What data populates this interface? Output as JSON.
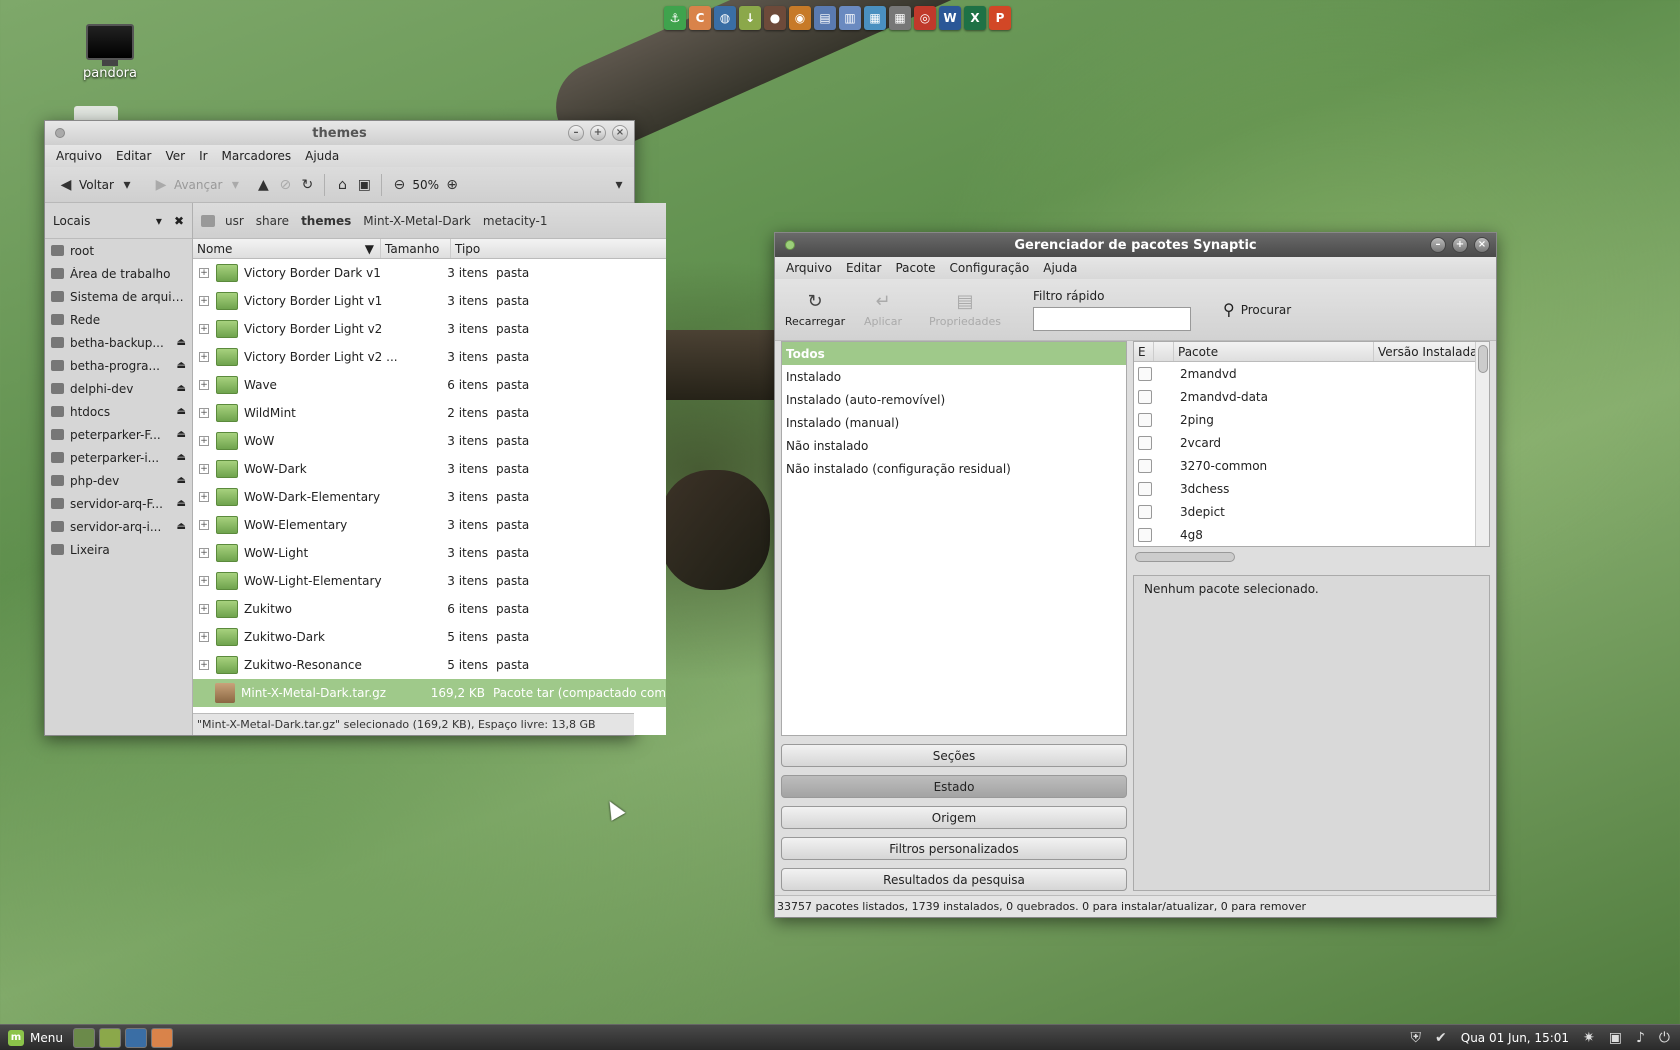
{
  "desktop": {
    "icons": [
      {
        "label": "pandora"
      }
    ]
  },
  "launcher": {
    "icons": [
      {
        "name": "anchor-icon",
        "color": "#3fa34d",
        "glyph": "⚓"
      },
      {
        "name": "c-app-icon",
        "color": "#d9834a",
        "glyph": "C"
      },
      {
        "name": "globe-icon",
        "color": "#3a6ea5",
        "glyph": "◍"
      },
      {
        "name": "install-icon",
        "color": "#8ba84a",
        "glyph": "↓"
      },
      {
        "name": "record-icon",
        "color": "#6d4a3a",
        "glyph": "●"
      },
      {
        "name": "eye-icon",
        "color": "#c77a28",
        "glyph": "◉"
      },
      {
        "name": "document-icon",
        "color": "#5a7ab0",
        "glyph": "▤"
      },
      {
        "name": "chart-icon",
        "color": "#6a8ac0",
        "glyph": "▥"
      },
      {
        "name": "monitor-icon",
        "color": "#4a90c0",
        "glyph": "▦"
      },
      {
        "name": "calc-icon",
        "color": "#777777",
        "glyph": "▦"
      },
      {
        "name": "lifebuoy-icon",
        "color": "#c0392b",
        "glyph": "◎"
      },
      {
        "name": "word-icon",
        "color": "#2b5797",
        "glyph": "W"
      },
      {
        "name": "excel-icon",
        "color": "#1e7145",
        "glyph": "X"
      },
      {
        "name": "powerpoint-icon",
        "color": "#d24726",
        "glyph": "P"
      }
    ]
  },
  "themes_window": {
    "title": "themes",
    "menu": [
      "Arquivo",
      "Editar",
      "Ver",
      "Ir",
      "Marcadores",
      "Ajuda"
    ],
    "toolbar": {
      "back": "Voltar",
      "forward": "Avançar",
      "zoom": "50%"
    },
    "sidebar": {
      "title": "Locais",
      "items": [
        {
          "label": "root",
          "eject": false
        },
        {
          "label": "Área de trabalho",
          "eject": false
        },
        {
          "label": "Sistema de arquivos",
          "eject": false
        },
        {
          "label": "Rede",
          "eject": false
        },
        {
          "label": "betha-backup...",
          "eject": true
        },
        {
          "label": "betha-progra...",
          "eject": true
        },
        {
          "label": "delphi-dev",
          "eject": true
        },
        {
          "label": "htdocs",
          "eject": true
        },
        {
          "label": "peterparker-F...",
          "eject": true
        },
        {
          "label": "peterparker-i...",
          "eject": true
        },
        {
          "label": "php-dev",
          "eject": true
        },
        {
          "label": "servidor-arq-F...",
          "eject": true
        },
        {
          "label": "servidor-arq-i...",
          "eject": true
        },
        {
          "label": "Lixeira",
          "eject": false
        }
      ]
    },
    "path": [
      "usr",
      "share",
      "themes",
      "Mint-X-Metal-Dark",
      "metacity-1"
    ],
    "columns": {
      "name": "Nome",
      "size": "Tamanho",
      "type": "Tipo"
    },
    "files": [
      {
        "name": "Victory Border Dark v1",
        "size": "3 itens",
        "type": "pasta"
      },
      {
        "name": "Victory Border Light v1",
        "size": "3 itens",
        "type": "pasta"
      },
      {
        "name": "Victory Border Light v2",
        "size": "3 itens",
        "type": "pasta"
      },
      {
        "name": "Victory Border Light v2 ...",
        "size": "3 itens",
        "type": "pasta"
      },
      {
        "name": "Wave",
        "size": "6 itens",
        "type": "pasta"
      },
      {
        "name": "WildMint",
        "size": "2 itens",
        "type": "pasta"
      },
      {
        "name": "WoW",
        "size": "3 itens",
        "type": "pasta"
      },
      {
        "name": "WoW-Dark",
        "size": "3 itens",
        "type": "pasta"
      },
      {
        "name": "WoW-Dark-Elementary",
        "size": "3 itens",
        "type": "pasta"
      },
      {
        "name": "WoW-Elementary",
        "size": "3 itens",
        "type": "pasta"
      },
      {
        "name": "WoW-Light",
        "size": "3 itens",
        "type": "pasta"
      },
      {
        "name": "WoW-Light-Elementary",
        "size": "3 itens",
        "type": "pasta"
      },
      {
        "name": "Zukitwo",
        "size": "6 itens",
        "type": "pasta"
      },
      {
        "name": "Zukitwo-Dark",
        "size": "5 itens",
        "type": "pasta"
      },
      {
        "name": "Zukitwo-Resonance",
        "size": "5 itens",
        "type": "pasta"
      }
    ],
    "selected_file": {
      "name": "Mint-X-Metal-Dark.tar.gz",
      "size": "169,2 KB",
      "type": "Pacote tar (compactado com"
    },
    "status": "\"Mint-X-Metal-Dark.tar.gz\" selecionado (169,2 KB), Espaço livre: 13,8 GB"
  },
  "synaptic_window": {
    "title": "Gerenciador de pacotes Synaptic",
    "menu": [
      "Arquivo",
      "Editar",
      "Pacote",
      "Configuração",
      "Ajuda"
    ],
    "toolbar": {
      "reload": "Recarregar",
      "apply": "Aplicar",
      "properties": "Propriedades",
      "filter_label": "Filtro rápido",
      "search": "Procurar"
    },
    "categories": [
      "Todos",
      "Instalado",
      "Instalado (auto-removível)",
      "Instalado (manual)",
      "Não instalado",
      "Não instalado (configuração residual)"
    ],
    "filter_buttons": [
      "Seções",
      "Estado",
      "Origem",
      "Filtros personalizados",
      "Resultados da pesquisa"
    ],
    "active_filter": "Estado",
    "columns": {
      "status": "E",
      "package": "Pacote",
      "installed_version": "Versão Instalada"
    },
    "packages": [
      "2mandvd",
      "2mandvd-data",
      "2ping",
      "2vcard",
      "3270-common",
      "3dchess",
      "3depict",
      "4g8"
    ],
    "description": "Nenhum pacote selecionado.",
    "status": "33757 pacotes listados, 1739 instalados, 0 quebrados. 0 para instalar/atualizar, 0 para remover"
  },
  "taskbar": {
    "menu_label": "Menu",
    "clock": "Qua 01 Jun, 15:01"
  }
}
